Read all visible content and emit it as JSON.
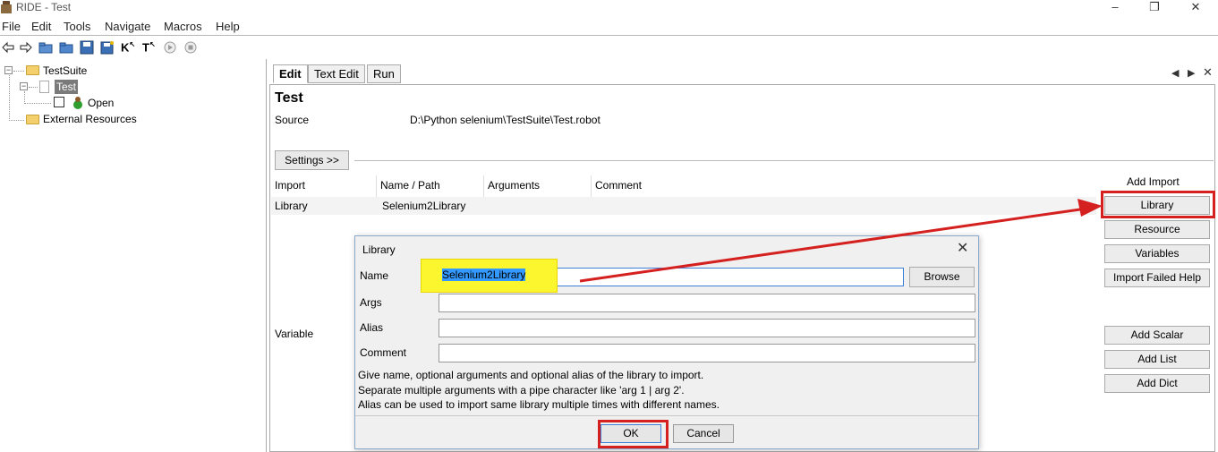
{
  "window": {
    "title": "RIDE - Test"
  },
  "menu": [
    "File",
    "Edit",
    "Tools",
    "Navigate",
    "Macros",
    "Help"
  ],
  "tree": {
    "suite": "TestSuite",
    "test": "Test",
    "keyword": "Open",
    "external": "External Resources"
  },
  "tabs": [
    "Edit",
    "Text Edit",
    "Run"
  ],
  "editor": {
    "title": "Test",
    "source_label": "Source",
    "source_value": "D:\\Python selenium\\TestSuite\\Test.robot",
    "settings_button": "Settings >>",
    "columns": [
      "Import",
      "Name / Path",
      "Arguments",
      "Comment"
    ],
    "rows": [
      {
        "import": "Library",
        "name": "Selenium2Library",
        "args": "",
        "comment": ""
      }
    ],
    "variable_label": "Variable"
  },
  "side": {
    "add_import": "Add Import",
    "library": "Library",
    "resource": "Resource",
    "variables": "Variables",
    "import_failed_help": "Import Failed Help",
    "add_scalar": "Add Scalar",
    "add_list": "Add List",
    "add_dict": "Add Dict"
  },
  "dialog": {
    "title": "Library",
    "close": "✕",
    "name_label": "Name",
    "name_value": "Selenium2Library",
    "browse": "Browse",
    "args_label": "Args",
    "alias_label": "Alias",
    "comment_label": "Comment",
    "help1": "Give name, optional arguments and optional alias of the library to import.",
    "help2": "Separate multiple arguments with a pipe character like 'arg 1 | arg 2'.",
    "help3": "Alias can be used to import same library multiple times with different names.",
    "ok": "OK",
    "cancel": "Cancel"
  },
  "colors": {
    "annotation_red": "#d52020",
    "highlight_yellow": "#fbf62e",
    "selection_blue": "#3399ff"
  }
}
